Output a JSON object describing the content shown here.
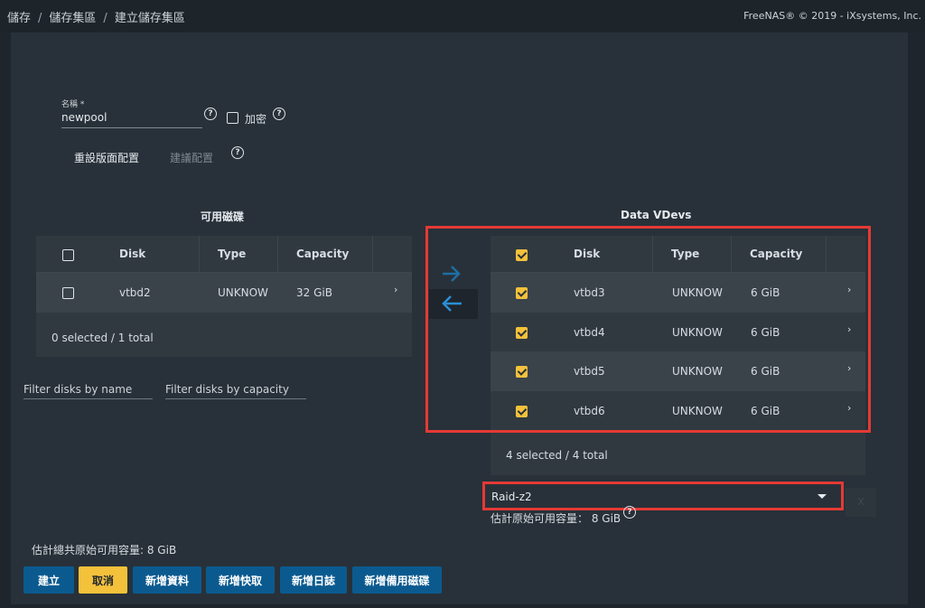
{
  "topbar": {
    "breadcrumb": [
      "儲存",
      "儲存集區",
      "建立儲存集區"
    ],
    "separator": "/",
    "copyright": "FreeNAS® © 2019 - iXsystems, Inc."
  },
  "form": {
    "name_label": "名稱 *",
    "name_value": "newpool",
    "encryption_label": "加密",
    "help_glyph": "?",
    "reset_layout_label": "重設版面配置",
    "suggest_layout_label": "建議配置"
  },
  "available_disks": {
    "title": "可用磁碟",
    "columns": [
      "Disk",
      "Type",
      "Capacity"
    ],
    "rows": [
      {
        "disk": "vtbd2",
        "type": "UNKNOW",
        "capacity": "32 GiB",
        "checked": false
      }
    ],
    "footer": "0 selected / 1 total",
    "filter_name_placeholder": "Filter disks by name",
    "filter_capacity_placeholder": "Filter disks by capacity"
  },
  "data_vdevs": {
    "title": "Data VDevs",
    "columns": [
      "Disk",
      "Type",
      "Capacity"
    ],
    "rows": [
      {
        "disk": "vtbd3",
        "type": "UNKNOW",
        "capacity": "6 GiB",
        "checked": true
      },
      {
        "disk": "vtbd4",
        "type": "UNKNOW",
        "capacity": "6 GiB",
        "checked": true
      },
      {
        "disk": "vtbd5",
        "type": "UNKNOW",
        "capacity": "6 GiB",
        "checked": true
      },
      {
        "disk": "vtbd6",
        "type": "UNKNOW",
        "capacity": "6 GiB",
        "checked": true
      }
    ],
    "footer": "4 selected / 4 total",
    "layout_value": "Raid-z2",
    "estimated_capacity": "估計原始可用容量： 8 GiB",
    "remove_glyph": "X"
  },
  "summary": {
    "total_estimated": "估計總共原始可用容量: 8 GiB"
  },
  "buttons": {
    "create": "建立",
    "cancel": "取消",
    "add_data": "新增資料",
    "add_cache": "新增快取",
    "add_log": "新增日誌",
    "add_spare": "新增備用磁碟"
  },
  "icons": {
    "move_right": "arrow-right-icon",
    "move_left": "arrow-left-icon",
    "row_expand": "chevron-right-icon",
    "dropdown": "caret-down-icon"
  },
  "colors": {
    "accent_blue": "#0b5a8f",
    "accent_yellow": "#f4c13b",
    "highlight_red": "#e53935",
    "background": "#1e252c",
    "card": "#283139"
  }
}
